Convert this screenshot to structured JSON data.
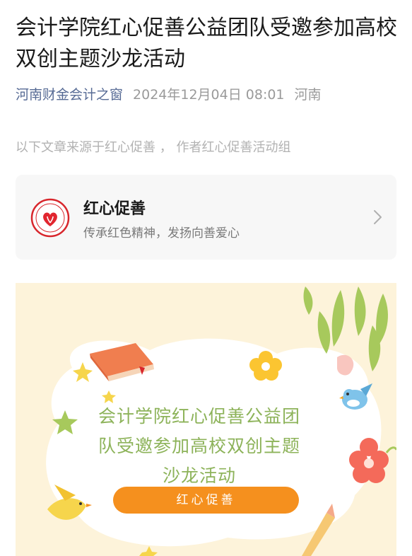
{
  "article": {
    "title": "会计学院红心促善公益团队受邀参加高校双创主题沙龙活动",
    "account_name": "河南财金会计之窗",
    "datetime": "2024年12月04日 08:01",
    "region": "河南",
    "source_line": "以下文章来源于红心促善 ， 作者红心促善活动组"
  },
  "profile_card": {
    "name": "红心促善",
    "description": "传承红色精神，发扬向善爱心",
    "logo_icon": "heart-logo-icon",
    "chevron_icon": "chevron-right-icon"
  },
  "banner": {
    "title": "会计学院红心促善公益团队受邀参加高校双创主题沙龙活动",
    "button_label": "红心促善",
    "colors": {
      "background": "#fdf3da",
      "title": "#8db35a",
      "button": "#f5901e"
    }
  }
}
